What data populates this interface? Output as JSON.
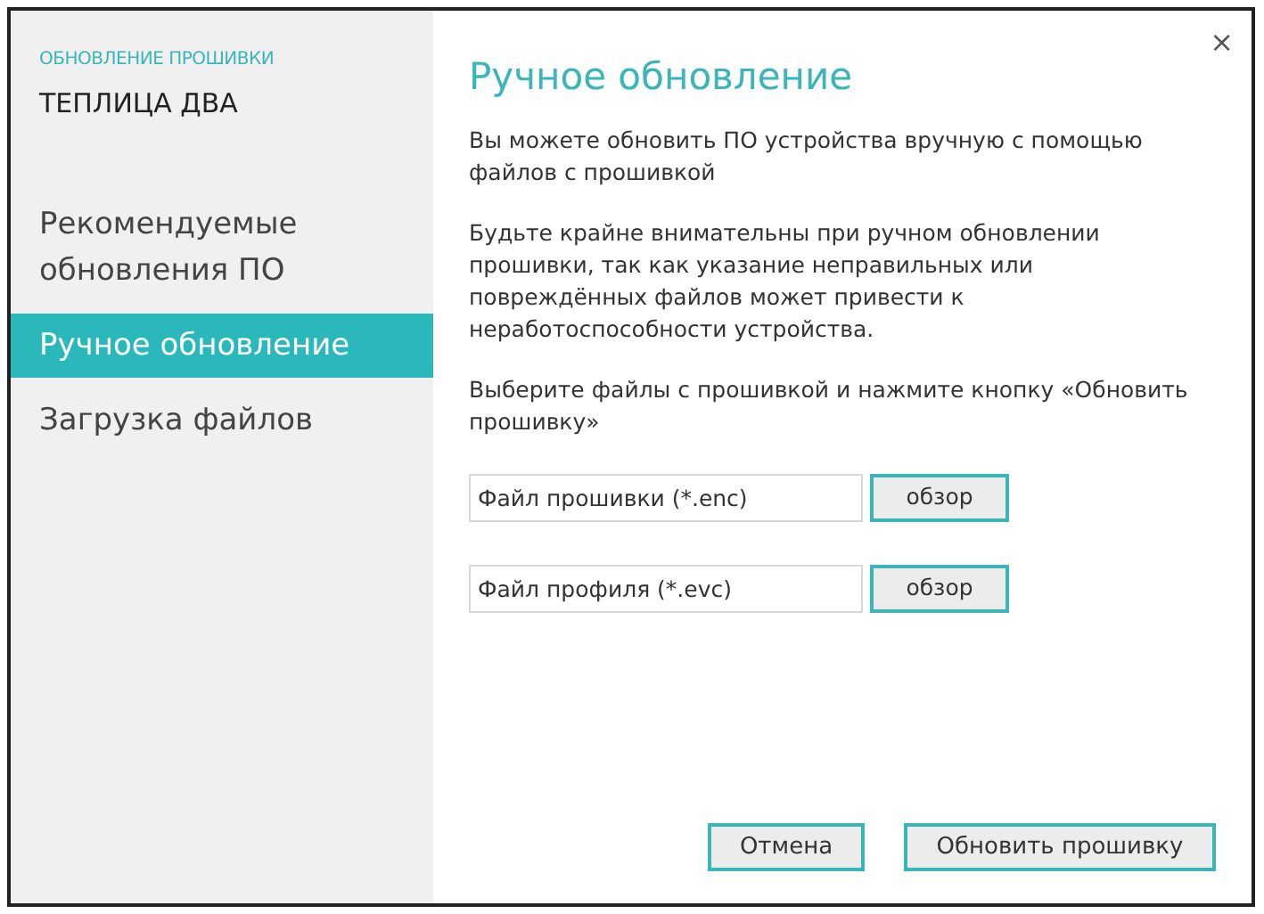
{
  "sidebar": {
    "caption": "ОБНОВЛЕНИЕ ПРОШИВКИ",
    "device": "ТЕПЛИЦА ДВА",
    "items": [
      {
        "label": "Рекомендуемые обновления ПО",
        "selected": false
      },
      {
        "label": "Ручное обновление",
        "selected": true
      },
      {
        "label": "Загрузка файлов",
        "selected": false
      }
    ]
  },
  "close": "×",
  "content": {
    "title": "Ручное обновление",
    "paragraphs": [
      "Вы можете обновить ПО устройства вручную с помощью файлов с прошивкой",
      "Будьте крайне внимательны при ручном обновлении прошивки, так как указание неправильных или повреждённых файлов может привести к неработоспособности устройства.",
      "Выберите файлы с прошивкой и нажмите кнопку «Обновить прошивку»"
    ],
    "files": [
      {
        "placeholder": "Файл прошивки (*.enc)",
        "button": "обзор"
      },
      {
        "placeholder": "Файл профиля (*.evc)",
        "button": "обзор"
      }
    ]
  },
  "buttons": [
    "Отмена",
    "Обновить прошивку"
  ]
}
